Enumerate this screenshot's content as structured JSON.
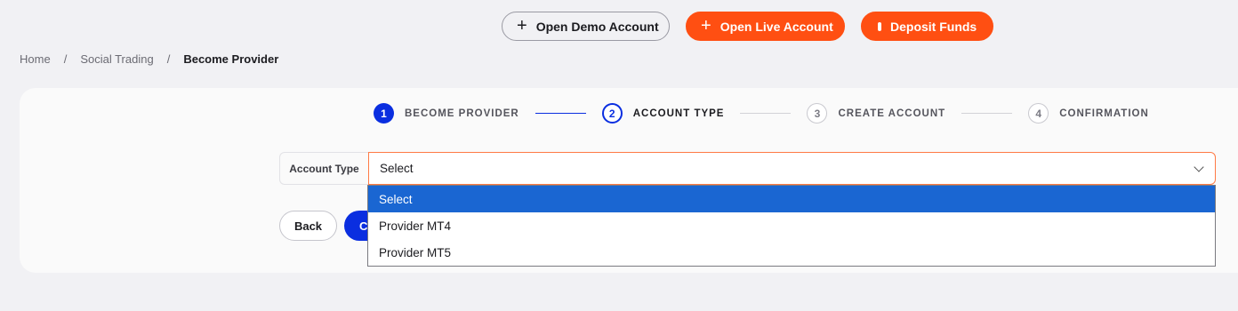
{
  "header": {
    "demo_button": "Open Demo Account",
    "live_button": "Open Live Account",
    "deposit_button": "Deposit Funds"
  },
  "breadcrumb": {
    "items": [
      "Home",
      "Social Trading"
    ],
    "separator": "/",
    "current": "Become Provider"
  },
  "stepper": {
    "steps": [
      {
        "number": "1",
        "label": "BECOME PROVIDER",
        "state": "done"
      },
      {
        "number": "2",
        "label": "ACCOUNT TYPE",
        "state": "active"
      },
      {
        "number": "3",
        "label": "CREATE ACCOUNT",
        "state": "todo"
      },
      {
        "number": "4",
        "label": "CONFIRMATION",
        "state": "todo"
      }
    ]
  },
  "form": {
    "account_type_label": "Account Type",
    "account_type_value": "Select",
    "options": [
      "Select",
      "Provider MT4",
      "Provider MT5"
    ],
    "back_button": "Back",
    "continue_button": "C"
  },
  "colors": {
    "brand_orange": "#ff4f12",
    "brand_blue": "#0a2ee0",
    "dropdown_highlight": "#1a66d2"
  }
}
